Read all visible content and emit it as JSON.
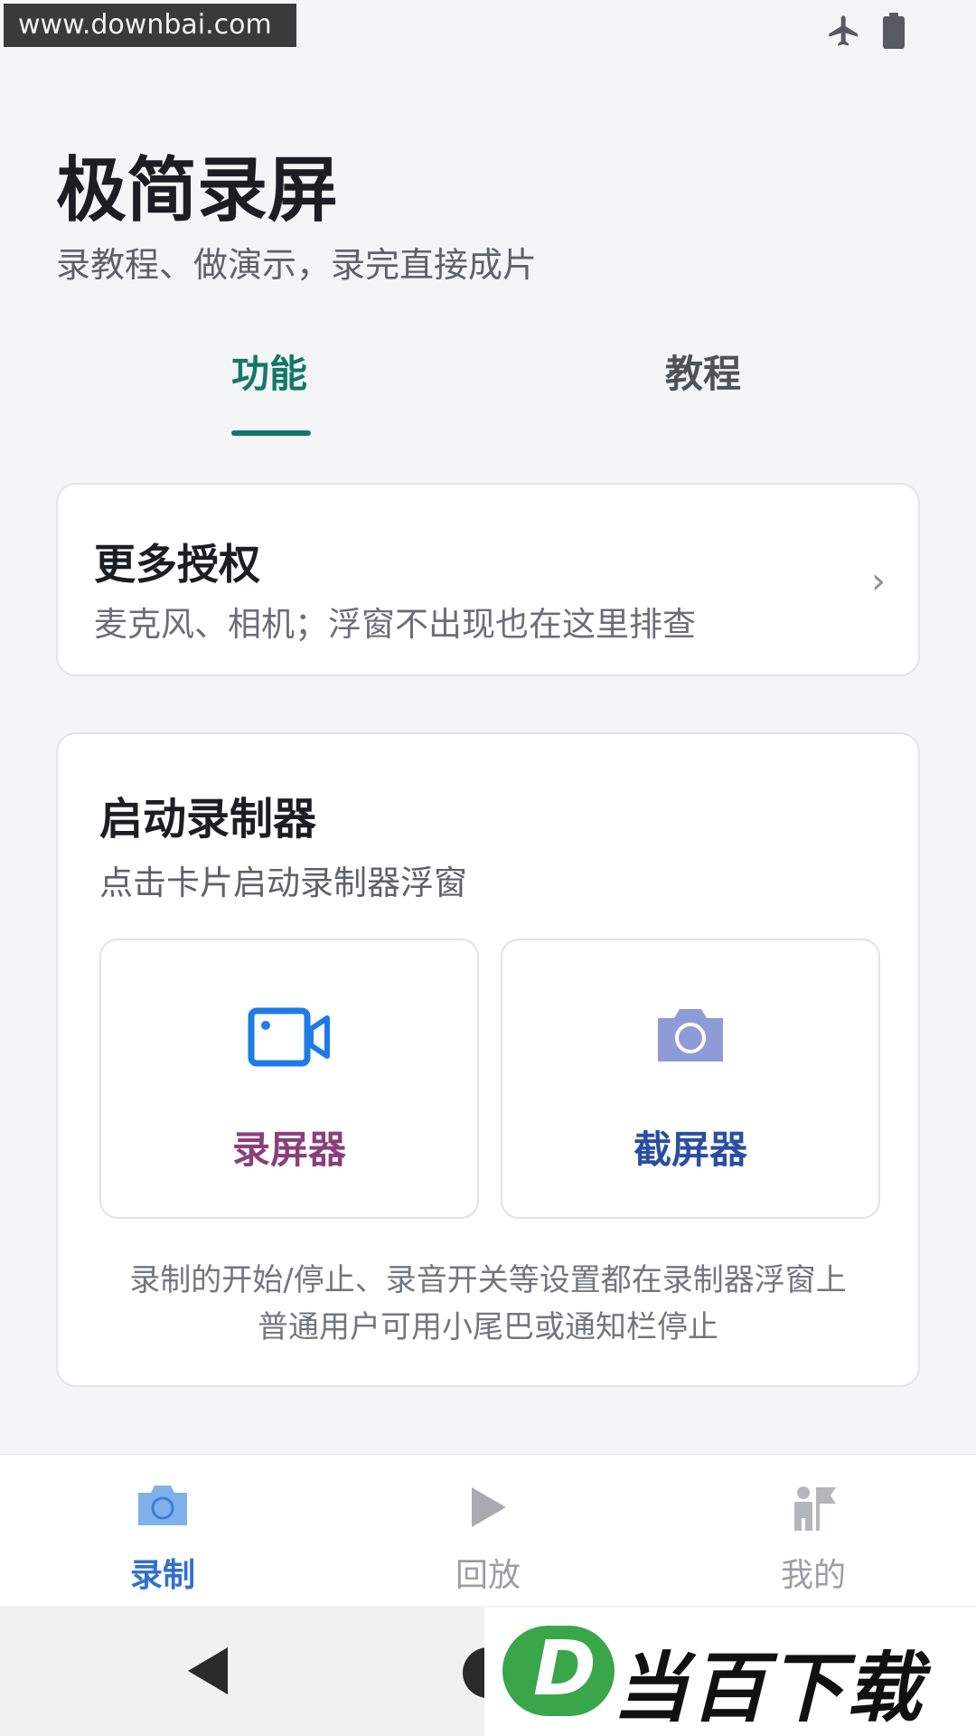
{
  "watermark_top": "www.downbai.com",
  "app": {
    "title": "极简录屏",
    "subtitle": "录教程、做演示，录完直接成片"
  },
  "tabs": [
    {
      "label": "功能",
      "active": true
    },
    {
      "label": "教程",
      "active": false
    }
  ],
  "permissions_card": {
    "title": "更多授权",
    "desc": "麦克风、相机；浮窗不出现也在这里排查",
    "chevron": "›"
  },
  "recorder_card": {
    "title": "启动录制器",
    "desc": "点击卡片启动录制器浮窗",
    "tools": [
      {
        "label": "录屏器",
        "icon": "video-camera-icon",
        "color": "#8a3f7b"
      },
      {
        "label": "截屏器",
        "icon": "camera-icon",
        "color": "#2b4ea2"
      }
    ],
    "note_line1": "录制的开始/停止、录音开关等设置都在录制器浮窗上",
    "note_line2": "普通用户可用小尾巴或通知栏停止"
  },
  "bottom_nav": [
    {
      "label": "录制",
      "icon": "camera-icon",
      "active": true
    },
    {
      "label": "回放",
      "icon": "play-icon",
      "active": false
    },
    {
      "label": "我的",
      "icon": "user-flag-icon",
      "active": false
    }
  ],
  "logo_watermark": {
    "mark": "D",
    "text": "当百下载"
  },
  "colors": {
    "accent": "#137867",
    "nav_active": "#2f6fd0",
    "record_label": "#8a3f7b",
    "screenshot_label": "#2b4ea2"
  }
}
